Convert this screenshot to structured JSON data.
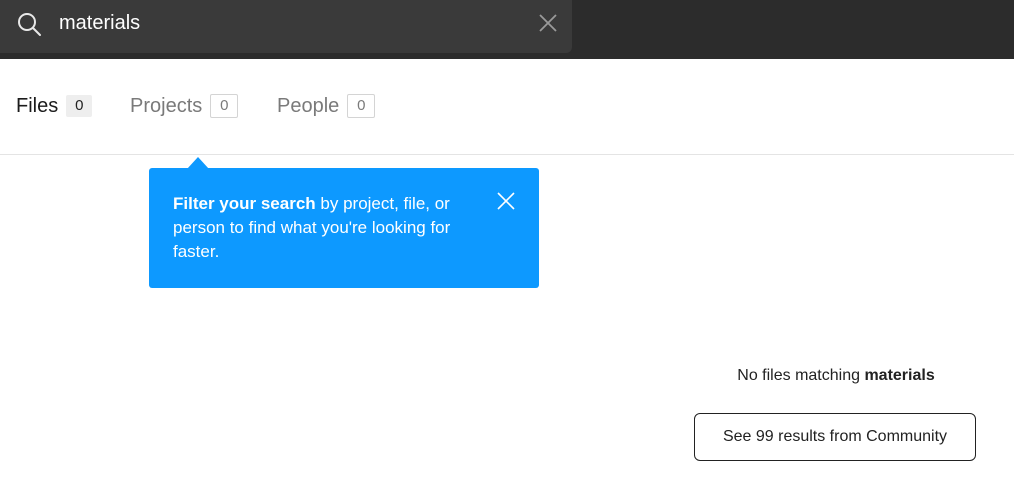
{
  "search": {
    "value": "materials",
    "icon": "search-icon",
    "clear_icon": "close-icon"
  },
  "tabs": [
    {
      "label": "Files",
      "count": "0",
      "active": true
    },
    {
      "label": "Projects",
      "count": "0",
      "active": false
    },
    {
      "label": "People",
      "count": "0",
      "active": false
    }
  ],
  "tooltip": {
    "bold_text": "Filter your search",
    "text": " by project, file, or person to find what you're looking for faster.",
    "close_icon": "close-icon",
    "color": "#0d99ff"
  },
  "empty_state": {
    "prefix": "No files matching ",
    "query": "materials",
    "button_label": "See 99 results from Community"
  },
  "colors": {
    "topbar": "#2c2c2c",
    "searchbox": "#3a3a3a",
    "accent": "#0d99ff"
  }
}
